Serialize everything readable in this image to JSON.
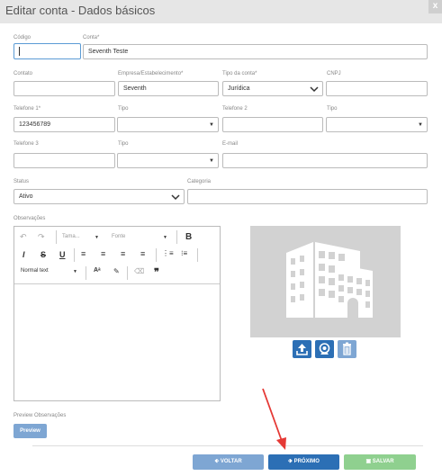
{
  "window": {
    "title": "Editar conta - Dados básicos",
    "close_label": "x"
  },
  "fields": {
    "codigo": {
      "label": "Código",
      "value": ""
    },
    "conta": {
      "label": "Conta*",
      "value": "Seventh Teste"
    },
    "contato": {
      "label": "Contato",
      "value": ""
    },
    "empresa": {
      "label": "Empresa/Estabelecimento*",
      "value": "Seventh"
    },
    "tipo_conta": {
      "label": "Tipo da conta*",
      "value": "Jurídica"
    },
    "cnpj": {
      "label": "CNPJ",
      "value": ""
    },
    "telefone1": {
      "label": "Telefone 1*",
      "value": "123456789"
    },
    "tipo1": {
      "label": "Tipo",
      "value": ""
    },
    "telefone2": {
      "label": "Telefone 2",
      "value": ""
    },
    "tipo2": {
      "label": "Tipo",
      "value": ""
    },
    "telefone3": {
      "label": "Telefone 3",
      "value": ""
    },
    "tipo3": {
      "label": "Tipo",
      "value": ""
    },
    "email": {
      "label": "E-mail",
      "value": ""
    },
    "status": {
      "label": "Status",
      "value": "Ativo"
    },
    "categoria": {
      "label": "Categoria",
      "value": ""
    }
  },
  "observacoes": {
    "label": "Observações",
    "size_placeholder": "Tama...",
    "font_placeholder": "Fonte",
    "paragraph_style": "Normal text"
  },
  "preview": {
    "label": "Preview Observações",
    "button": "Preview"
  },
  "footer": {
    "back": "VOLTAR",
    "next": "PRÓXIMO",
    "save": "SALVAR"
  },
  "colors": {
    "primary": "#2c6fb5",
    "secondary": "#7ea6d3",
    "success": "#8fd08f",
    "titlebar": "#e6e6e6",
    "annotation_arrow": "#e53935"
  }
}
